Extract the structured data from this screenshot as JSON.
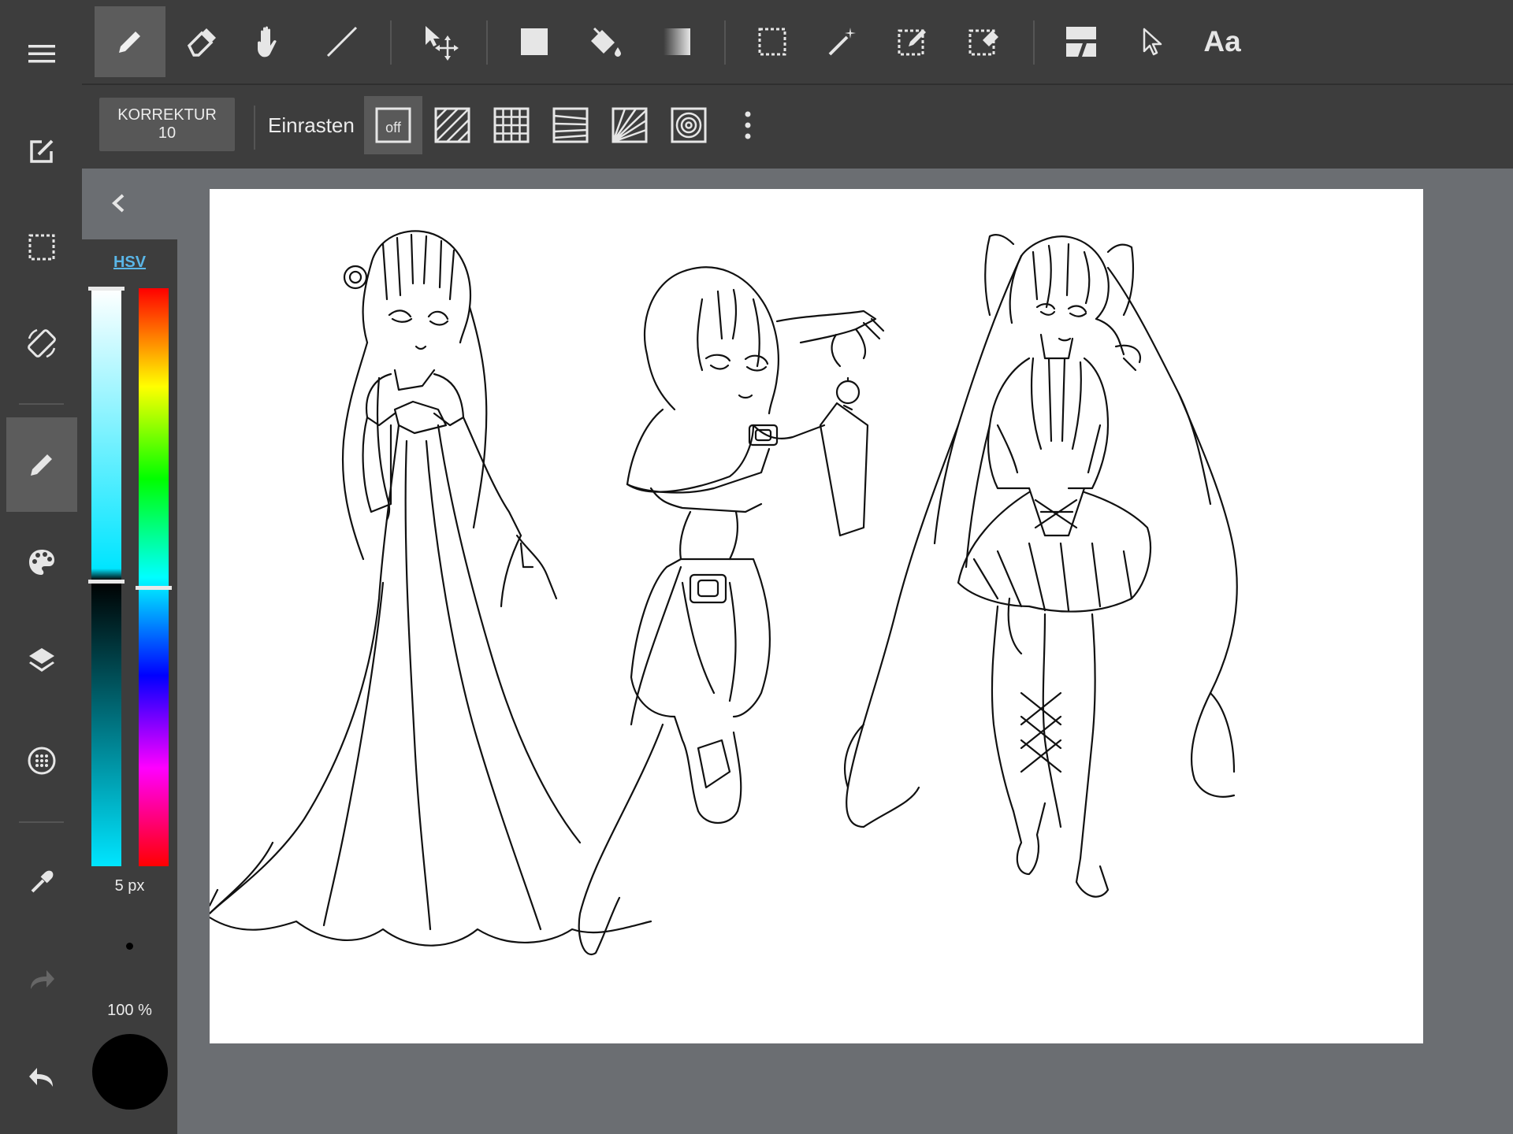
{
  "sidebar": {
    "items": [
      {
        "icon": "menu-icon"
      },
      {
        "icon": "edit-canvas-icon"
      },
      {
        "icon": "selection-icon"
      },
      {
        "icon": "rotate-icon"
      },
      {
        "icon": "brush-icon",
        "active": true
      },
      {
        "icon": "palette-icon"
      },
      {
        "icon": "layers-icon"
      },
      {
        "icon": "material-icon"
      },
      {
        "icon": "eyedropper-icon"
      },
      {
        "icon": "redo-icon"
      },
      {
        "icon": "undo-icon"
      }
    ]
  },
  "toolbar": {
    "tools": [
      "pen-icon",
      "eraser-icon",
      "hand-icon",
      "line-icon",
      "move-icon",
      "fill-rect-icon",
      "bucket-icon",
      "gradient-icon",
      "select-rect-icon",
      "magic-wand-icon",
      "select-pen-icon",
      "select-eraser-icon",
      "frame-divider-icon",
      "pointer-icon",
      "text-icon"
    ],
    "text_tool_label": "Aa"
  },
  "subtoolbar": {
    "correction_label": "KORREKTUR",
    "correction_value": "10",
    "snap_label": "Einrasten",
    "snap_off_label": "off"
  },
  "colorpanel": {
    "mode_label": "HSV",
    "brush_size": "5 px",
    "opacity": "100 %",
    "current_color": "#000000"
  },
  "colors": {
    "panel_bg": "#3d3d3d",
    "workspace_bg": "#6b6e72",
    "active_tool": "#5c5c5c",
    "hsv_link": "#5ab6e8"
  }
}
